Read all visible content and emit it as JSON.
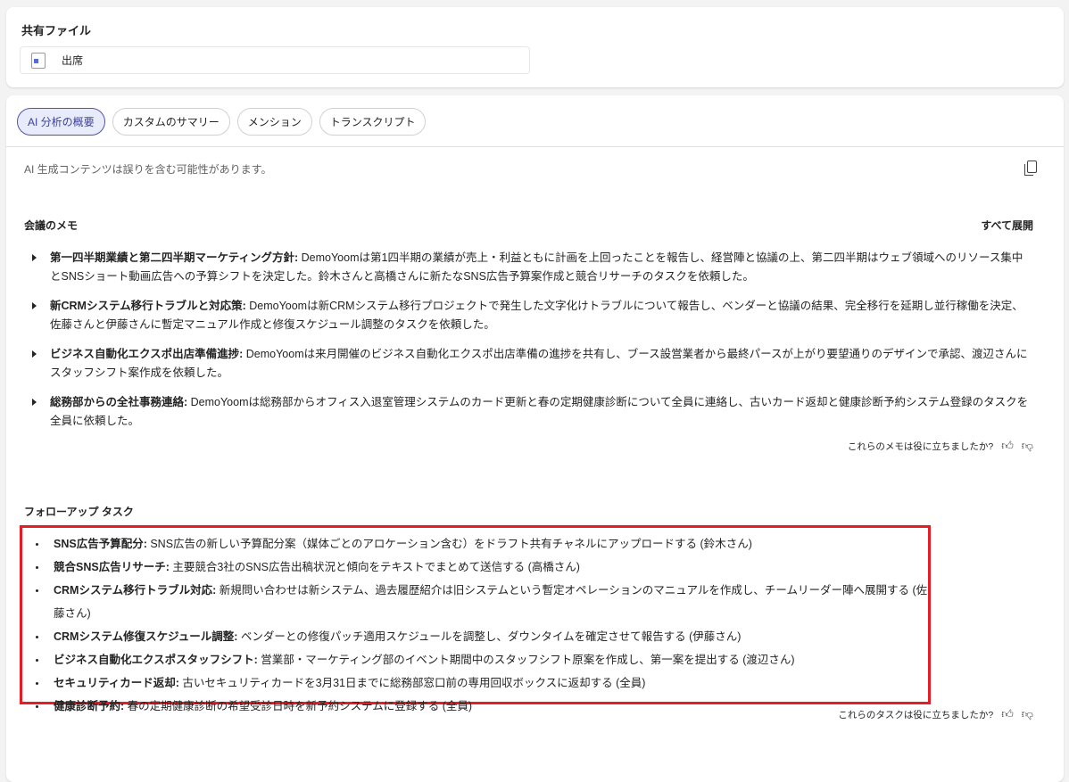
{
  "shared_files": {
    "title": "共有ファイル",
    "file_name": "出席"
  },
  "tabs": [
    {
      "label": "AI 分析の概要",
      "active": true
    },
    {
      "label": "カスタムのサマリー"
    },
    {
      "label": "メンション"
    },
    {
      "label": "トランスクリプト"
    }
  ],
  "disclaimer": "AI 生成コンテンツは誤りを含む可能性があります。",
  "notes": {
    "title": "会議のメモ",
    "expand_all": "すべて展開",
    "items": [
      {
        "title": "第一四半期業績と第二四半期マーケティング方針:",
        "text": " DemoYoomは第1四半期の業績が売上・利益ともに計画を上回ったことを報告し、経営陣と協議の上、第二四半期はウェブ領域へのリソース集中とSNSショート動画広告への予算シフトを決定した。鈴木さんと高橋さんに新たなSNS広告予算案作成と競合リサーチのタスクを依頼した。"
      },
      {
        "title": "新CRMシステム移行トラブルと対応策:",
        "text": " DemoYoomは新CRMシステム移行プロジェクトで発生した文字化けトラブルについて報告し、ベンダーと協議の結果、完全移行を延期し並行稼働を決定、佐藤さんと伊藤さんに暫定マニュアル作成と修復スケジュール調整のタスクを依頼した。"
      },
      {
        "title": "ビジネス自動化エクスポ出店準備進捗:",
        "text": " DemoYoomは来月開催のビジネス自動化エクスポ出店準備の進捗を共有し、ブース設営業者から最終パースが上がり要望通りのデザインで承認、渡辺さんにスタッフシフト案作成を依頼した。"
      },
      {
        "title": "総務部からの全社事務連絡:",
        "text": " DemoYoomは総務部からオフィス入退室管理システムのカード更新と春の定期健康診断について全員に連絡し、古いカード返却と健康診断予約システム登録のタスクを全員に依頼した。"
      }
    ],
    "feedback": "これらのメモは役に立ちましたか?"
  },
  "tasks": {
    "title": "フォローアップ タスク",
    "items": [
      {
        "title": "SNS広告予算配分:",
        "text": " SNS広告の新しい予算配分案（媒体ごとのアロケーション含む）をドラフト共有チャネルにアップロードする (鈴木さん)"
      },
      {
        "title": "競合SNS広告リサーチ:",
        "text": " 主要競合3社のSNS広告出稿状況と傾向をテキストでまとめて送信する (高橋さん)"
      },
      {
        "title": "CRMシステム移行トラブル対応:",
        "text": " 新規問い合わせは新システム、過去履歴紹介は旧システムという暫定オペレーションのマニュアルを作成し、チームリーダー陣へ展開する (佐藤さん)"
      },
      {
        "title": "CRMシステム修復スケジュール調整:",
        "text": " ベンダーとの修復パッチ適用スケジュールを調整し、ダウンタイムを確定させて報告する (伊藤さん)"
      },
      {
        "title": "ビジネス自動化エクスポスタッフシフト:",
        "text": " 営業部・マーケティング部のイベント期間中のスタッフシフト原案を作成し、第一案を提出する (渡辺さん)"
      },
      {
        "title": "セキュリティカード返却:",
        "text": " 古いセキュリティカードを3月31日までに総務部窓口前の専用回収ボックスに返却する (全員)"
      },
      {
        "title": "健康診断予約:",
        "text": " 春の定期健康診断の希望受診日時を新予約システムに登録する (全員)"
      }
    ],
    "feedback": "これらのタスクは役に立ちましたか?"
  },
  "colors": {
    "accent": "#4f52b2",
    "highlight": "#e81c24"
  }
}
